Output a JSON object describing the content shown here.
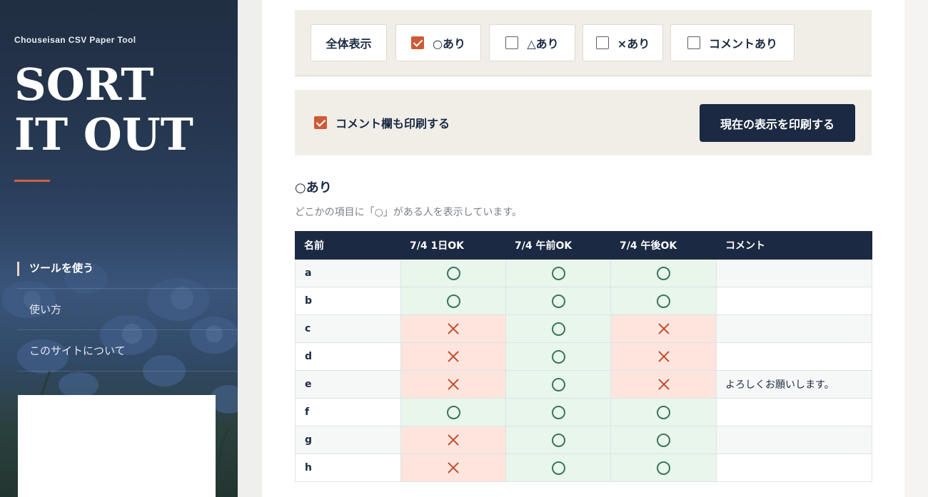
{
  "sidebar": {
    "brand_small": "Chouseisan CSV Paper Tool",
    "brand_line1": "SORT",
    "brand_line2": "IT OUT",
    "accent_color": "#d2603c",
    "nav": [
      {
        "label": "ツールを使う",
        "active": true
      },
      {
        "label": "使い方",
        "active": false
      },
      {
        "label": "このサイトについて",
        "active": false
      }
    ]
  },
  "filters": [
    {
      "label": "全体表示",
      "has_checkbox": false,
      "checked": false
    },
    {
      "label": "○あり",
      "has_checkbox": true,
      "checked": true
    },
    {
      "label": "△あり",
      "has_checkbox": true,
      "checked": false
    },
    {
      "label": "×あり",
      "has_checkbox": true,
      "checked": false
    },
    {
      "label": "コメントあり",
      "has_checkbox": true,
      "checked": false
    }
  ],
  "print": {
    "include_comment_label": "コメント欄も印刷する",
    "include_comment_checked": true,
    "button_label": "現在の表示を印刷する"
  },
  "section": {
    "title": "○あり",
    "description": "どこかの項目に「○」がある人を表示しています。"
  },
  "table": {
    "columns": [
      "名前",
      "7/4 1日OK",
      "7/4 午前OK",
      "7/4 午後OK",
      "コメント"
    ],
    "rows": [
      {
        "name": "a",
        "marks": [
          "ok",
          "ok",
          "ok"
        ],
        "comment": ""
      },
      {
        "name": "b",
        "marks": [
          "ok",
          "ok",
          "ok"
        ],
        "comment": ""
      },
      {
        "name": "c",
        "marks": [
          "ng",
          "ok",
          "ng"
        ],
        "comment": ""
      },
      {
        "name": "d",
        "marks": [
          "ng",
          "ok",
          "ng"
        ],
        "comment": ""
      },
      {
        "name": "e",
        "marks": [
          "ng",
          "ok",
          "ng"
        ],
        "comment": "よろしくお願いします。"
      },
      {
        "name": "f",
        "marks": [
          "ok",
          "ok",
          "ok"
        ],
        "comment": ""
      },
      {
        "name": "g",
        "marks": [
          "ng",
          "ok",
          "ok"
        ],
        "comment": ""
      },
      {
        "name": "h",
        "marks": [
          "ng",
          "ok",
          "ok"
        ],
        "comment": ""
      }
    ]
  },
  "colors": {
    "navy": "#1b2942",
    "ok_bg": "#e8f6ec",
    "ng_bg": "#fde5de",
    "check_orange": "#cf5a36"
  }
}
